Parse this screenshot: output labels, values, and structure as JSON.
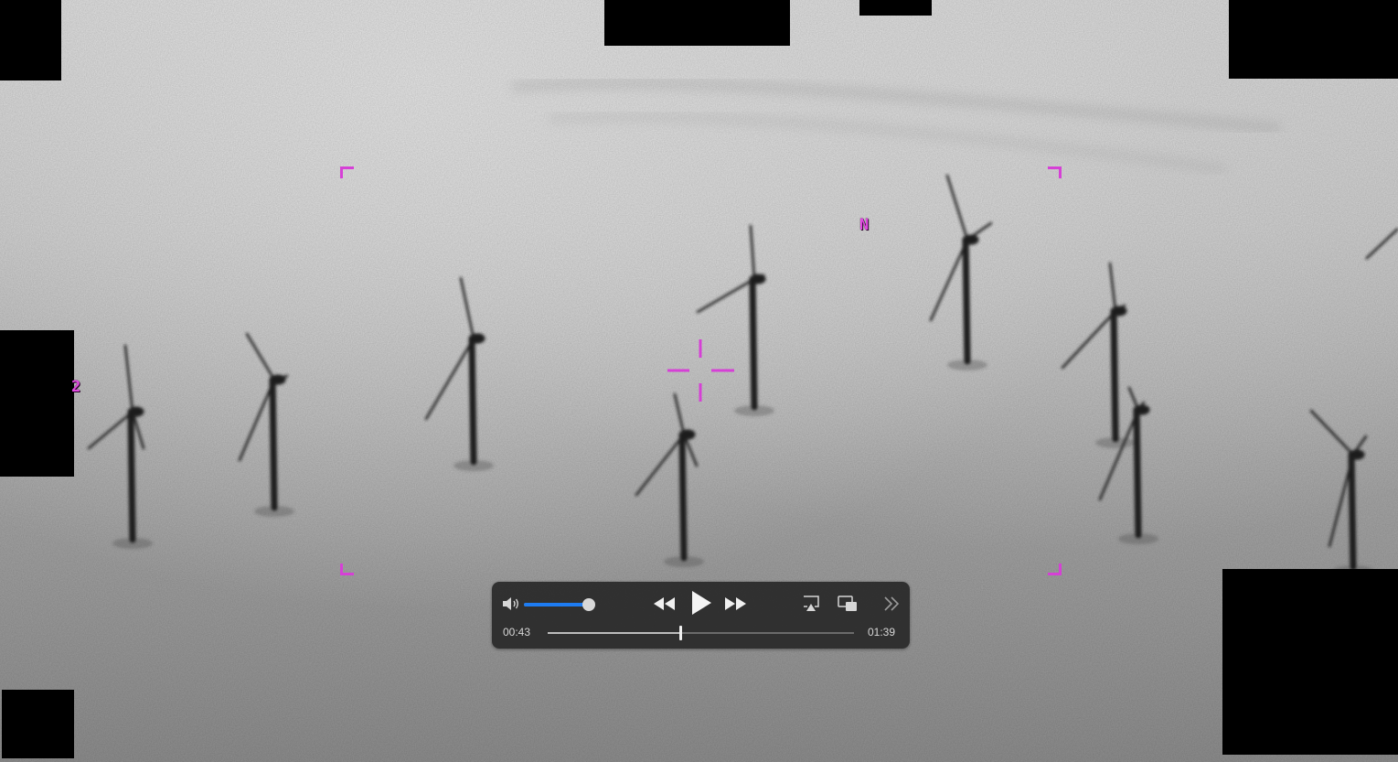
{
  "hud": {
    "heading_marker": "N",
    "edge_marker": "2",
    "color": "#d640d6"
  },
  "player": {
    "current_time": "00:43",
    "duration": "01:39",
    "progress_fraction": 0.434,
    "volume_fraction": 1.0,
    "accent_color": "#1e7cf2",
    "icons": {
      "volume": "speaker-icon",
      "rewind": "rewind-icon",
      "play": "play-icon",
      "fast_forward": "fast-forward-icon",
      "airplay": "airplay-icon",
      "pip": "picture-in-picture-icon",
      "more": "chevron-double-right-icon"
    }
  }
}
